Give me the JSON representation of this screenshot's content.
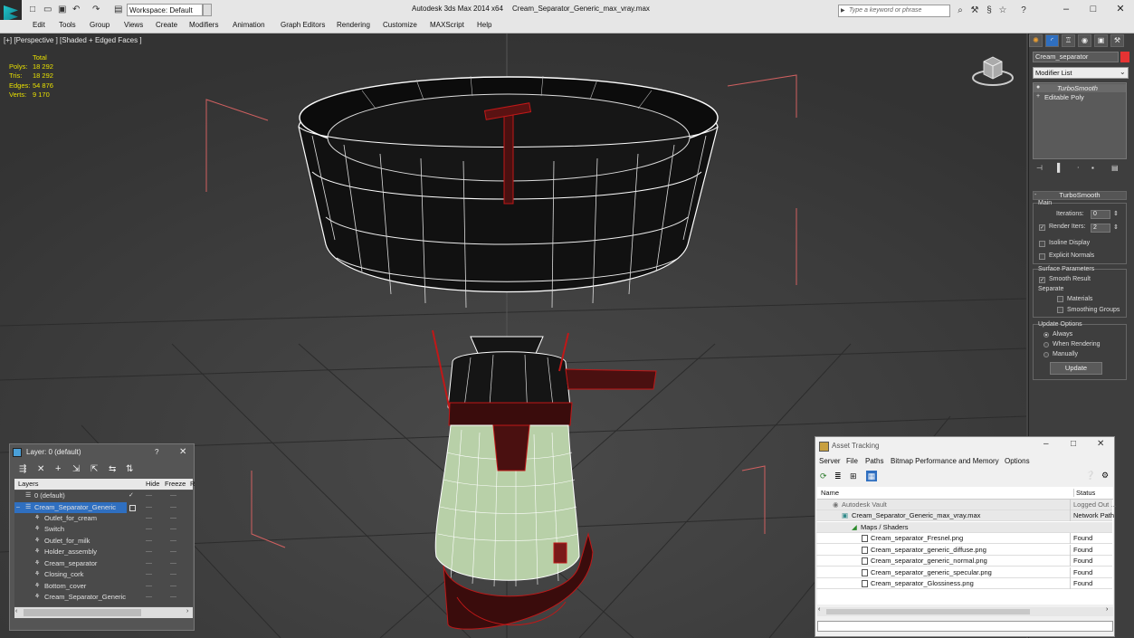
{
  "titlebar": {
    "workspace": "Workspace: Default",
    "app_title": "Autodesk 3ds Max  2014 x64",
    "file_title": "Cream_Separator_Generic_max_vray.max",
    "search_placeholder": "Type a keyword or phrase"
  },
  "menubar": [
    "Edit",
    "Tools",
    "Group",
    "Views",
    "Create",
    "Modifiers",
    "Animation",
    "Graph Editors",
    "Rendering",
    "Customize",
    "MAXScript",
    "Help"
  ],
  "viewport": {
    "label": "[+] [Perspective ] [Shaded + Edged Faces ]",
    "stats": {
      "header": "Total",
      "rows": [
        {
          "label": "Polys:",
          "value": "18 292"
        },
        {
          "label": "Tris:",
          "value": "18 292"
        },
        {
          "label": "Edges:",
          "value": "54 876"
        },
        {
          "label": "Verts:",
          "value": "9 170"
        }
      ]
    }
  },
  "command_panel": {
    "object_name": "Cream_separator",
    "modifier_list": "Modifier List",
    "stack": [
      "TurboSmooth",
      "Editable Poly"
    ],
    "rollout_title": "TurboSmooth",
    "main_group": "Main",
    "iterations_label": "Iterations:",
    "iterations_value": "0",
    "render_iters_label": "Render Iters:",
    "render_iters_value": "2",
    "isoline_label": "Isoline Display",
    "explicit_normals_label": "Explicit Normals",
    "surface_group": "Surface Parameters",
    "smooth_result_label": "Smooth Result",
    "separate_label": "Separate",
    "materials_label": "Materials",
    "smoothing_groups_label": "Smoothing Groups",
    "update_group": "Update Options",
    "always_label": "Always",
    "when_rendering_label": "When Rendering",
    "manually_label": "Manually",
    "update_button": "Update"
  },
  "layer_window": {
    "title": "Layer: 0 (default)",
    "help": "?",
    "columns": [
      "Layers",
      "Hide",
      "Freeze",
      "R"
    ],
    "rows": [
      {
        "name": "0 (default)"
      },
      {
        "name": "Cream_Separator_Generic"
      },
      {
        "name": "Outlet_for_cream"
      },
      {
        "name": "Switch"
      },
      {
        "name": "Outlet_for_milk"
      },
      {
        "name": "Holder_assembly"
      },
      {
        "name": "Cream_separator"
      },
      {
        "name": "Closing_cork"
      },
      {
        "name": "Bottom_cover"
      },
      {
        "name": "Cream_Separator_Generic"
      }
    ]
  },
  "asset_tracking": {
    "title": "Asset Tracking",
    "menu": [
      "Server",
      "File",
      "Paths",
      "Bitmap Performance and Memory",
      "Options"
    ],
    "columns": [
      "Name",
      "Status"
    ],
    "rows": [
      {
        "name": "Autodesk Vault",
        "status": "Logged Out ..."
      },
      {
        "name": "Cream_Separator_Generic_max_vray.max",
        "status": "Network Path"
      },
      {
        "name": "Maps / Shaders",
        "status": ""
      },
      {
        "name": "Cream_separator_Fresnel.png",
        "status": "Found"
      },
      {
        "name": "Cream_separator_generic_diffuse.png",
        "status": "Found"
      },
      {
        "name": "Cream_separator_generic_normal.png",
        "status": "Found"
      },
      {
        "name": "Cream_separator_generic_specular.png",
        "status": "Found"
      },
      {
        "name": "Cream_separator_Glossiness.png",
        "status": "Found"
      }
    ]
  },
  "colors": {
    "accent_select": "#3a7ad8",
    "object_color": "#e53333",
    "stats_text": "#e8e000",
    "wire_red": "#c01818",
    "body_green": "#b8d0a8"
  }
}
